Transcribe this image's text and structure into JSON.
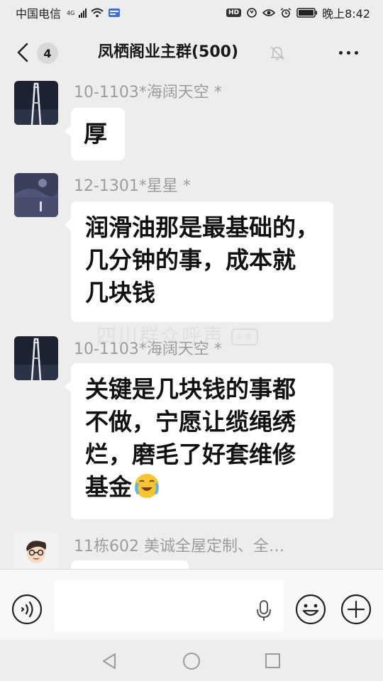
{
  "status_bar": {
    "carrier": "中国电信",
    "network": "4G",
    "right_badge": "HD",
    "time": "晚上8:42"
  },
  "header": {
    "unread_count": "4",
    "title": "凤栖阁业主群(500)"
  },
  "messages": [
    {
      "sender": "10-1103*海阔天空 *",
      "text": "厚",
      "avatar": "tower-photo"
    },
    {
      "sender": "12-1301*星星 *",
      "lines": [
        "润滑油那是最基础的，",
        "几分钟的事，成本就",
        "几块钱"
      ],
      "avatar": "night-sky-photo"
    },
    {
      "sender": "10-1103*海阔天空 *",
      "lines": [
        "关键是几块钱的事都",
        "不做，宁愿让缆绳绣",
        "烂，磨毛了好套维修",
        "基金"
      ],
      "emoji": "face-with-tears-emoji",
      "avatar": "tower-photo"
    },
    {
      "sender": "11栋602 美诚全屋定制、全…",
      "avatar": "cartoon-man-avatar"
    }
  ],
  "watermark": {
    "text": "四川群众呼声",
    "badge": "头条"
  },
  "input_bar": {
    "placeholder": ""
  },
  "colors": {
    "background": "#ededed",
    "bubble": "#ffffff",
    "sender": "#9c9c9c"
  }
}
